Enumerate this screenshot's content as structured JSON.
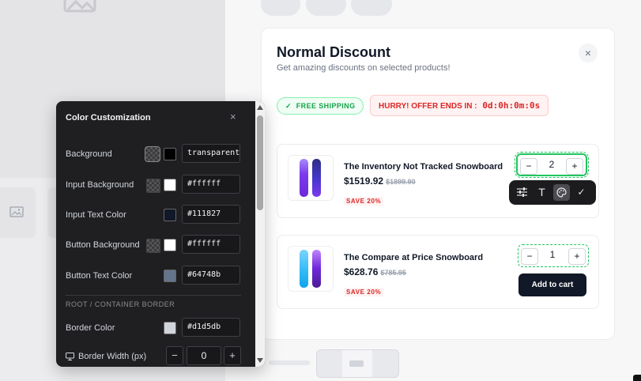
{
  "offer": {
    "title": "Normal Discount",
    "subtitle": "Get amazing discounts on selected products!",
    "close_symbol": "×",
    "free_shipping": "FREE SHIPPING",
    "hurry_text": "HURRY! OFFER ENDS IN :",
    "timer": "0d:0h:0m:0s"
  },
  "products": [
    {
      "name": "The Inventory Not Tracked Snowboard",
      "price": "$1519.92",
      "compare_price": "$1899.90",
      "save_label": "SAVE 20%",
      "quantity": "2",
      "colors": [
        "#7c3aed",
        "#4338ca"
      ]
    },
    {
      "name": "The Compare at Price Snowboard",
      "price": "$628.76",
      "compare_price": "$785.95",
      "save_label": "SAVE 20%",
      "quantity": "1",
      "add_to_cart": "Add to cart",
      "colors": [
        "#38bdf8",
        "#6d28d9"
      ]
    }
  ],
  "stepper": {
    "minus": "−",
    "plus": "+"
  },
  "toolbar": {
    "icons": [
      "sliders-icon",
      "text-icon",
      "palette-icon",
      "check-icon"
    ],
    "active": "palette-icon"
  },
  "color_panel": {
    "title": "Color Customization",
    "close_symbol": "×",
    "rows": [
      {
        "label": "Background",
        "value": "transparent",
        "swatch": "#000000"
      },
      {
        "label": "Input Background",
        "value": "#ffffff",
        "swatch": "#ffffff"
      },
      {
        "label": "Input Text Color",
        "value": "#111827",
        "swatch": "#111827"
      },
      {
        "label": "Button Background",
        "value": "#ffffff",
        "swatch": "#ffffff"
      },
      {
        "label": "Button Text Color",
        "value": "#64748b",
        "swatch": "#64748b"
      }
    ],
    "section_label": "ROOT / CONTAINER BORDER",
    "border_color": {
      "label": "Border Color",
      "value": "#d1d5db",
      "swatch": "#d1d5db"
    },
    "border_width": {
      "label": "Border Width (px)",
      "value": "0",
      "minus": "−",
      "plus": "+"
    }
  }
}
